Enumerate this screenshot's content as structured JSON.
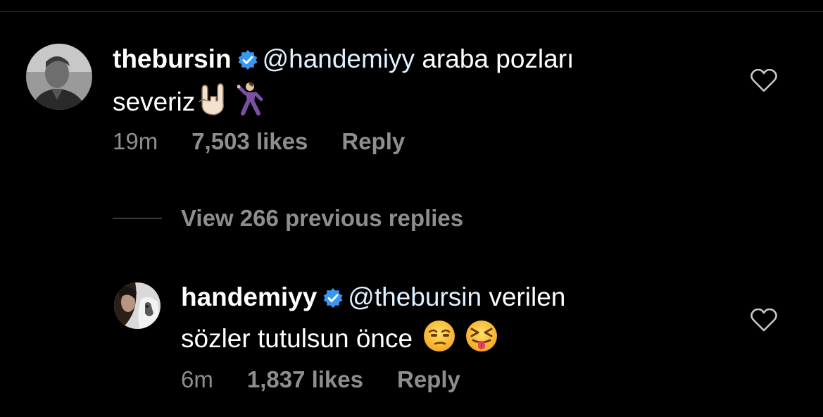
{
  "comments": [
    {
      "username": "thebursin",
      "mention": "@handemiyy",
      "text_line1": " araba pozları",
      "text_line2": "severiz",
      "emojis": [
        "rock-hand-emoji",
        "dancing-man-emoji"
      ],
      "time": "19m",
      "likes": "7,503 likes",
      "reply": "Reply"
    },
    {
      "username": "handemiyy",
      "mention": "@thebursin",
      "text_line1": " verilen",
      "text_line2": "sözler tutulsun önce",
      "emojis": [
        "unamused-face-emoji",
        "squinting-tongue-face-emoji"
      ],
      "time": "6m",
      "likes": "1,837 likes",
      "reply": "Reply"
    }
  ],
  "view_replies": "View 266 previous replies",
  "colors": {
    "background": "#000000",
    "text": "#ffffff",
    "secondary": "#8e8e8e",
    "verified": "#3897f0"
  }
}
